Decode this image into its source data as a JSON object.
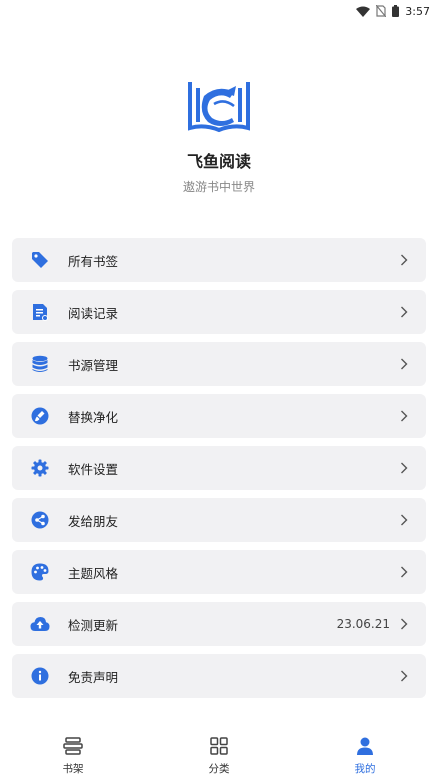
{
  "status_bar": {
    "time": "3:57"
  },
  "app": {
    "name": "飞鱼阅读",
    "slogan": "遨游书中世界"
  },
  "colors": {
    "accent": "#2f6fdf",
    "card_bg": "#f1f1f3"
  },
  "menu": {
    "items": [
      {
        "label": "所有书签",
        "icon": "bookmark-tag-icon",
        "value": ""
      },
      {
        "label": "阅读记录",
        "icon": "reading-record-icon",
        "value": ""
      },
      {
        "label": "书源管理",
        "icon": "database-icon",
        "value": ""
      },
      {
        "label": "替换净化",
        "icon": "clean-brush-icon",
        "value": ""
      },
      {
        "label": "软件设置",
        "icon": "gear-icon",
        "value": ""
      },
      {
        "label": "发给朋友",
        "icon": "share-icon",
        "value": ""
      },
      {
        "label": "主题风格",
        "icon": "palette-icon",
        "value": ""
      },
      {
        "label": "检测更新",
        "icon": "cloud-upload-icon",
        "value": "23.06.21"
      },
      {
        "label": "免责声明",
        "icon": "info-icon",
        "value": ""
      }
    ]
  },
  "bottom_nav": {
    "items": [
      {
        "label": "书架",
        "icon": "bookshelf-icon",
        "active": false
      },
      {
        "label": "分类",
        "icon": "grid-icon",
        "active": false
      },
      {
        "label": "我的",
        "icon": "person-icon",
        "active": true
      }
    ]
  }
}
